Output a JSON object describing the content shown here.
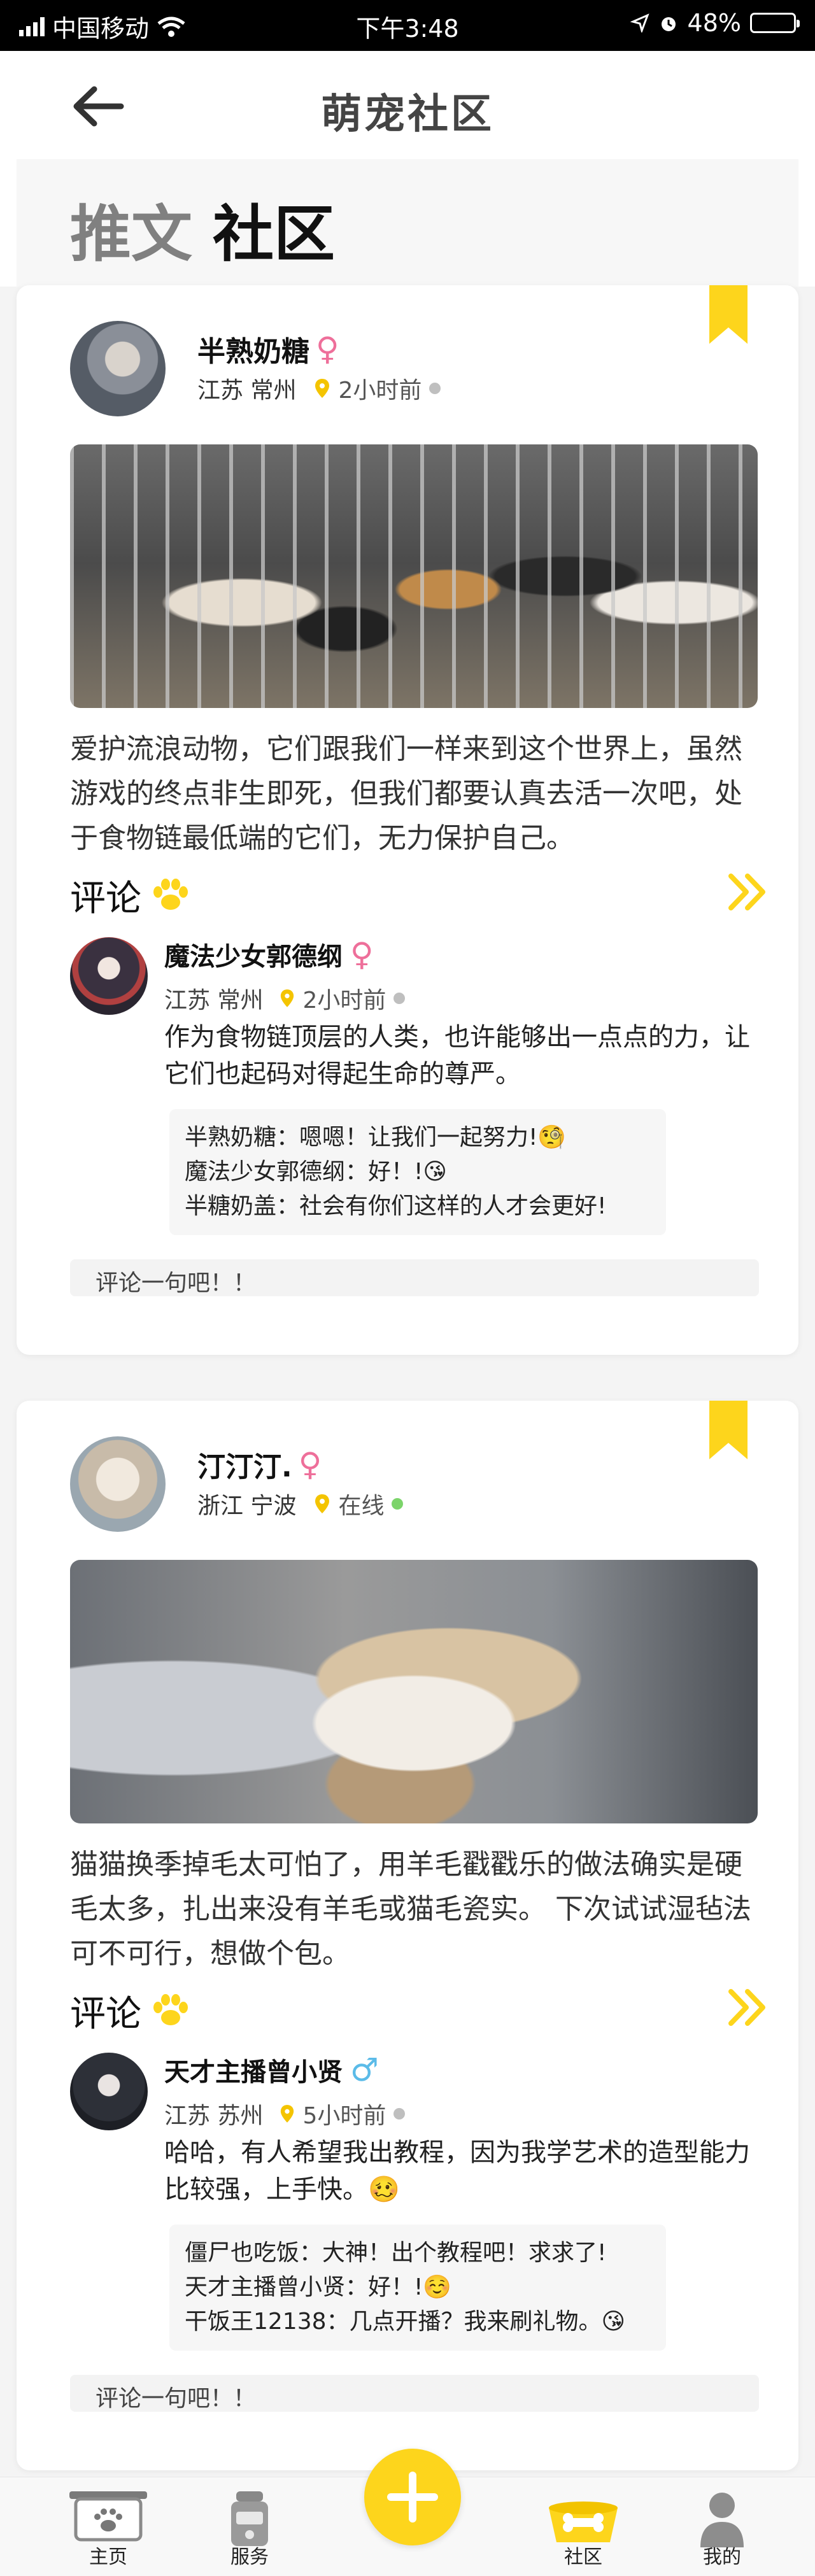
{
  "status_bar": {
    "carrier": "中国移动",
    "time": "下午3:48",
    "battery": "48%",
    "battery_level": 0.48
  },
  "header": {
    "title": "萌宠社区",
    "back_icon": "arrow-left-icon"
  },
  "tabs": [
    {
      "label": "推文",
      "active": false
    },
    {
      "label": "社区",
      "active": true
    }
  ],
  "posts": [
    {
      "author": "半熟奶糖",
      "gender": "♀",
      "location": "江苏 常州",
      "status": "2小时前",
      "post_text": "爱护流浪动物，它们跟我们一样来到这个世界上，虽然游戏的终点非生即死，但我们都要认真去活一次吧，处于食物链最低端的它们，无力保护自己。",
      "comments_label": "评论",
      "comment": {
        "author": "魔法少女郭德纲",
        "gender": "♀",
        "location": "江苏 常州",
        "time": "2小时前",
        "text": "作为食物链顶层的人类，也许能够出一点点的力，让它们也起码对得起生命的尊严。",
        "replies": [
          "半熟奶糖：嗯嗯！让我们一起努力!🧐",
          "魔法少女郭德纲：好！!😘",
          "半糖奶盖：社会有你们这样的人才会更好!"
        ]
      },
      "comment_placeholder": "评论一句吧！！"
    },
    {
      "author": "汀汀汀.",
      "gender": "♀",
      "location": "浙江 宁波",
      "status": "在线",
      "post_text": "猫猫换季掉毛太可怕了，用羊毛戳戳乐的做法确实是硬毛太多，扎出来没有羊毛或猫毛瓷实。 下次试试湿毡法可不可行，想做个包。",
      "comments_label": "评论",
      "comment": {
        "author": "天才主播曾小贤",
        "gender": "♂",
        "location": "江苏 苏州",
        "time": "5小时前",
        "text": "哈哈，有人希望我出教程，因为我学艺术的造型能力比较强，上手快。🥴",
        "replies": [
          "僵尸也吃饭：大神！出个教程吧！求求了!",
          "天才主播曾小贤：好！!☺️",
          "干饭王12138：几点开播？我来刷礼物。😘"
        ]
      },
      "comment_placeholder": "评论一句吧！！"
    }
  ],
  "bottom_nav": {
    "home": "主页",
    "service": "服务",
    "community": "社区",
    "me": "我的"
  },
  "colors": {
    "accent": "#fdd51c",
    "female": "#ee6f9a",
    "male": "#5bbbe8",
    "online": "#7cd46a"
  }
}
